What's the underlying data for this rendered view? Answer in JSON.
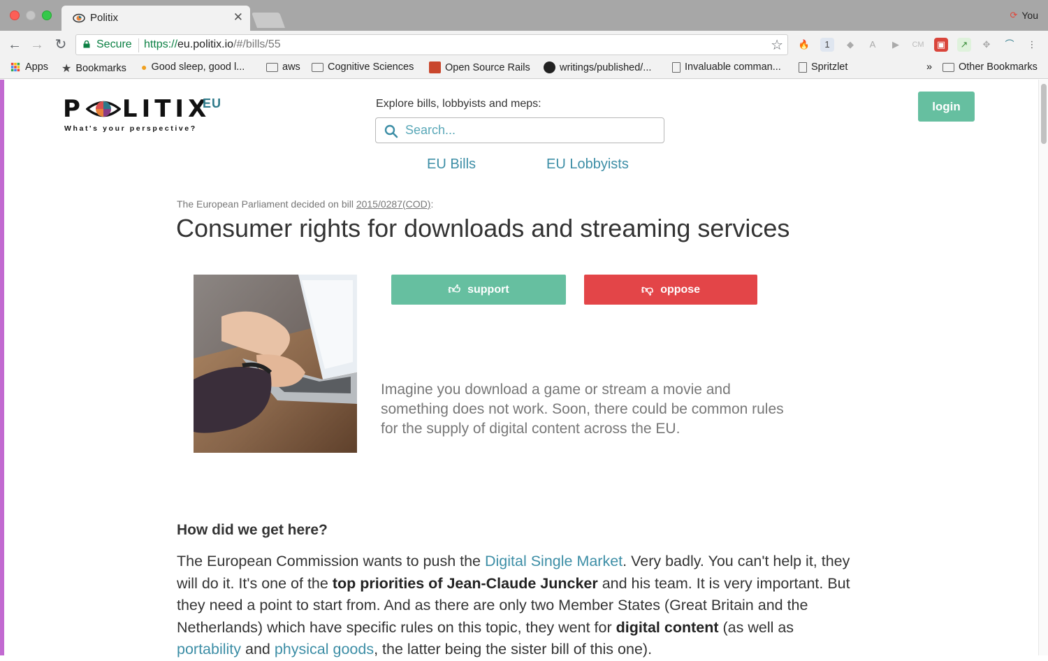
{
  "browser": {
    "tab_title": "Politix",
    "profile_name": "You",
    "secure_label": "Secure",
    "url_scheme": "https://",
    "url_host": "eu.politix.io",
    "url_path": "/#/bills/55",
    "bookmarks": [
      "Apps",
      "Bookmarks",
      "Good sleep, good l...",
      "aws",
      "Cognitive Sciences",
      "Open Source Rails",
      "writings/published/...",
      "Invaluable comman...",
      "Spritzlet"
    ],
    "other_bookmarks": "Other Bookmarks",
    "overflow": "»"
  },
  "header": {
    "logo_word_left": "P",
    "logo_word_right": "LITIX",
    "logo_suffix": "EU",
    "logo_tagline": "What's your perspective?",
    "explore_label": "Explore bills, lobbyists and meps:",
    "search_placeholder": "Search...",
    "login_label": "login",
    "nav": [
      "EU Bills",
      "EU Lobbyists"
    ]
  },
  "bill": {
    "decided_prefix": "The European Parliament decided on bill ",
    "bill_code": "2015/0287(COD)",
    "decided_suffix": ":",
    "title": "Consumer rights for downloads and streaming services",
    "support_label": "support",
    "oppose_label": "oppose",
    "summary": "Imagine you download a game or stream a movie and something does not work. Soon, there could be common rules for the supply of digital content across the EU."
  },
  "section": {
    "heading": "How did we get here?",
    "p1": "The European Commission wants to push the ",
    "link1": "Digital Single Market",
    "p2": ". Very badly. You can't help it, they will do it. It's one of the ",
    "bold1": "top priorities of Jean-Claude Juncker",
    "p3": " and his team. It is very important. But they need a point to start from. And as there are only two Member States (Great Britain and the Netherlands) which have specific rules on this topic, they went for ",
    "bold2": "digital content",
    "p4": " (as well as ",
    "link2": "portability",
    "p5": " and ",
    "link3": "physical goods",
    "p6": ", the latter being the sister bill of this one)."
  },
  "colors": {
    "accent_teal": "#66bfa0",
    "oppose_red": "#e34548",
    "link_blue": "#3d8ea6"
  }
}
